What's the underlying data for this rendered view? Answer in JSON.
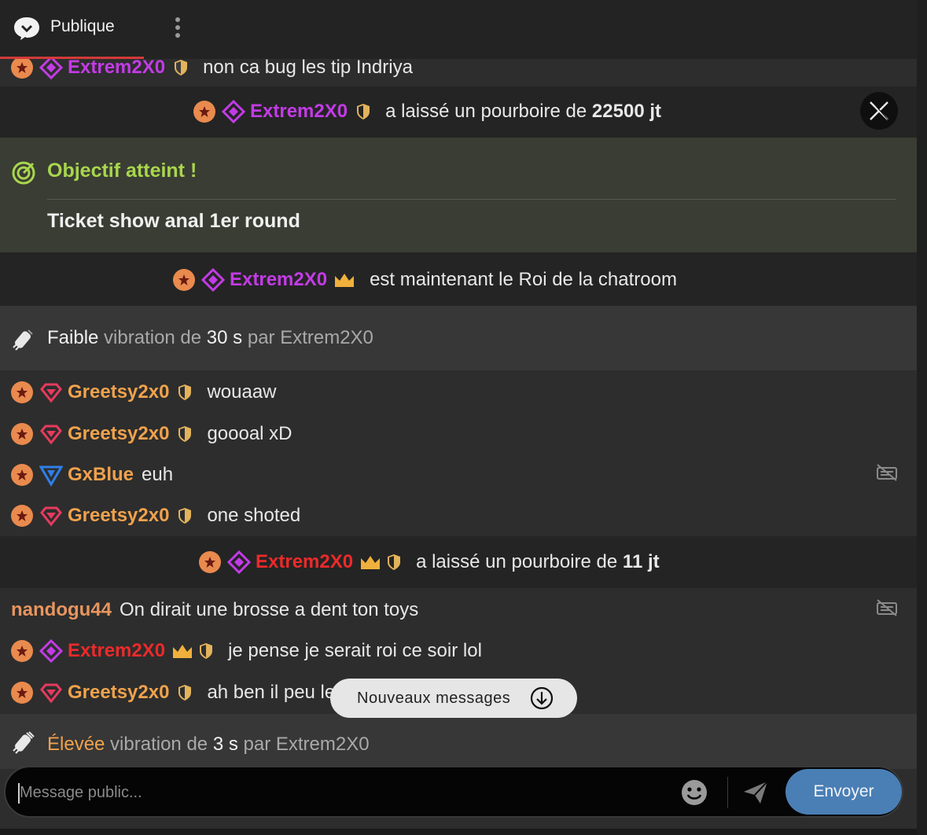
{
  "header": {
    "title": "Publique"
  },
  "messages": {
    "m0": {
      "user": "Extrem2X0",
      "text": "non ca bug les tip Indriya"
    },
    "tip1": {
      "user": "Extrem2X0",
      "text_pre": "a laissé un pourboire de ",
      "amount": "22500 jt"
    },
    "goal": {
      "title": "Objectif atteint !",
      "subtitle": "Ticket show anal 1er round"
    },
    "king": {
      "user": "Extrem2X0",
      "text": "est maintenant le Roi de la chatroom"
    },
    "vib1": {
      "level": "Faible",
      "mid": " vibration de ",
      "duration": "30 s",
      "by": " par Extrem2X0"
    },
    "m1": {
      "user": "Greetsy2x0",
      "text": "wouaaw"
    },
    "m2": {
      "user": "Greetsy2x0",
      "text": "goooal xD"
    },
    "m3": {
      "user": "GxBlue",
      "text": "euh"
    },
    "m4": {
      "user": "Greetsy2x0",
      "text": "one shoted"
    },
    "tip2": {
      "user": "Extrem2X0",
      "text_pre": "a laissé un pourboire de ",
      "amount": "11 jt"
    },
    "m5": {
      "user": "nandogu44",
      "text": "On dirait une brosse a dent ton toys"
    },
    "m6": {
      "user": "Extrem2X0",
      "text": "je pense je serait roi ce soir lol"
    },
    "m7": {
      "user": "Greetsy2x0",
      "text": "ah ben il peu le xD"
    },
    "vib2": {
      "level": "Élevée",
      "mid": " vibration de ",
      "duration": "3 s",
      "by": " par Extrem2X0"
    }
  },
  "new_messages_label": "Nouveaux messages",
  "composer": {
    "placeholder": "Message public...",
    "send_label": "Envoyer"
  },
  "colors": {
    "accent": "#4a7fb5",
    "goal": "#a9d64e",
    "purple_user": "#c33be6",
    "orange_user": "#f0a24c",
    "red_user": "#ec2a2a"
  },
  "icons": [
    "chat-bubble-icon",
    "kebab-menu-icon",
    "star-badge-icon",
    "diamond-badge-icon",
    "heart-diamond-icon",
    "triangle-badge-icon",
    "shield-icon",
    "crown-icon",
    "x-close-icon",
    "target-icon",
    "vibration-icon",
    "hide-message-icon",
    "arrow-down-circle-icon",
    "emoji-icon",
    "send-icon"
  ]
}
